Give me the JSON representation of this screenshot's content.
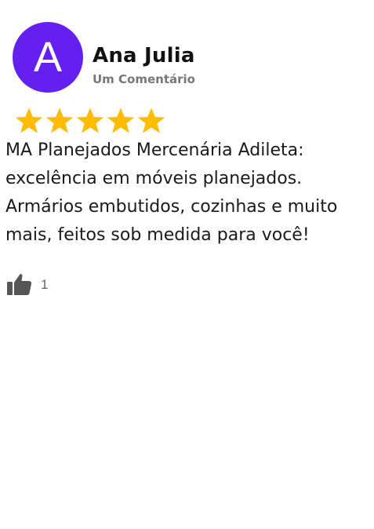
{
  "review": {
    "avatar_letter": "A",
    "avatar_color": "#6320ee",
    "author_name": "Ana Julia",
    "author_subtitle": "Um Comentário",
    "rating": 5,
    "rating_max": 5,
    "star_color": "#ffbb00",
    "text": "MA Planejados Mercenária Adileta: excelência em móveis planejados. Armários embutidos, cozinhas e muito mais, feitos sob medida para você!",
    "like_icon": "thumbs-up-icon",
    "like_count": "1"
  }
}
